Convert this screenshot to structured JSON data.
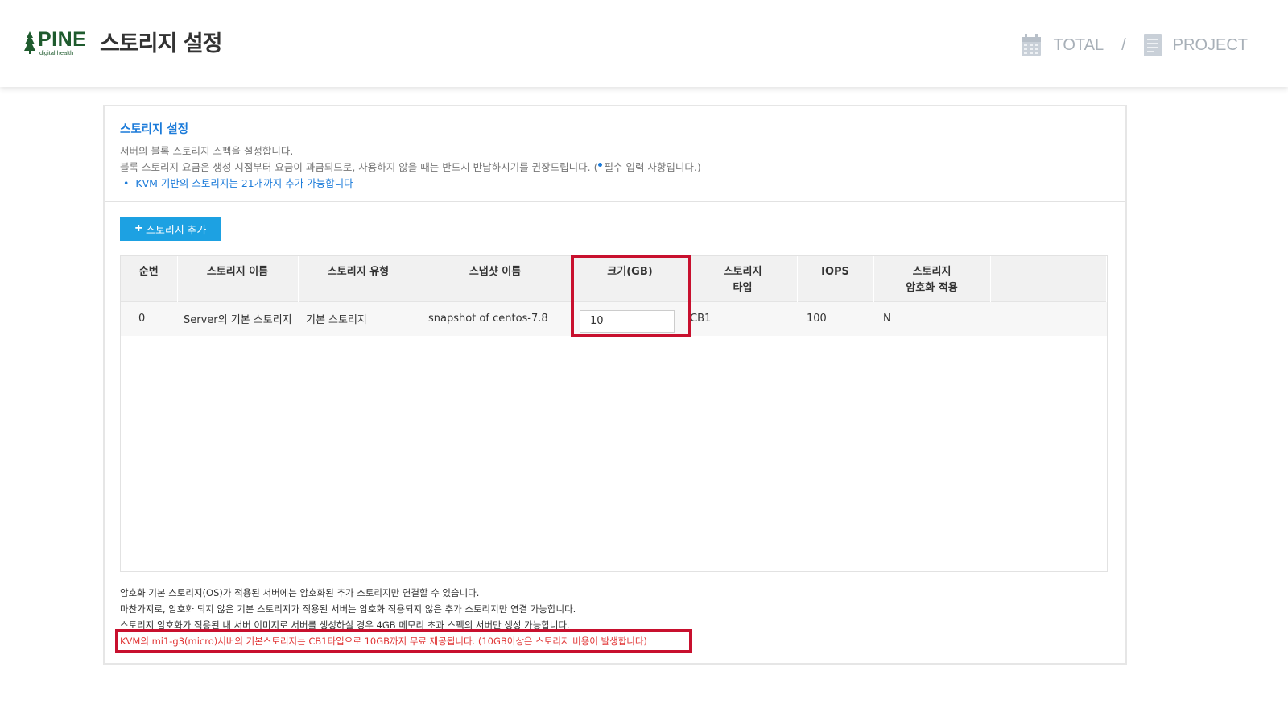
{
  "header": {
    "logo": {
      "brand": "PINE",
      "sub": "digital health"
    },
    "title": "스토리지 설정",
    "nav": [
      {
        "label": "TOTAL",
        "icon": "calendar-icon"
      },
      {
        "label": "PROJECT",
        "icon": "document-icon"
      }
    ],
    "separator": "/"
  },
  "section": {
    "title": "스토리지 설정",
    "desc1": "서버의 블록 스토리지 스펙을 설정합니다.",
    "desc2_prefix": "블록 스토리지 요금은 생성 시점부터 요금이 과금되므로, 사용하지 않을 때는 반드시 반납하시기를 권장드립니다. (",
    "desc2_suffix": "필수 입력 사항입니다.)",
    "bullet": "KVM 기반의 스토리지는 21개까지 추가 가능합니다"
  },
  "toolbar": {
    "add_label": "스토리지 추가"
  },
  "table": {
    "headers": [
      "순번",
      "스토리지 이름",
      "스토리지 유형",
      "스냅샷 이름",
      "크기(GB)",
      "스토리지\n타입",
      "IOPS",
      "스토리지\n암호화 적용"
    ],
    "rows": [
      {
        "no": "0",
        "name": "Server의 기본 스토리지",
        "type": "기본 스토리지",
        "snapshot": "snapshot of centos-7.8",
        "size": "10",
        "storage_type": "CB1",
        "iops": "100",
        "encrypt": "N"
      }
    ]
  },
  "notes": [
    "암호화 기본 스토리지(OS)가 적용된 서버에는 암호화된 추가 스토리지만 연결할 수 있습니다.",
    "마찬가지로, 암호화 되지 않은 기본 스토리지가 적용된 서버는 암호화 적용되지 않은 추가 스토리지만 연결 가능합니다.",
    "스토리지 암호화가 적용된 내 서버 이미지로 서버를 생성하실 경우 4GB 메모리 초과 스펙의 서버만 생성 가능합니다."
  ],
  "warning": "KVM의 mi1-g3(micro)서버의 기본스토리지는 CB1타입으로 10GB까지 무료 제공됩니다. (10GB이상은 스토리지 비용이 발생합니다)",
  "colors": {
    "accent": "#1a7ad9",
    "button": "#1da1e2",
    "highlight": "#c8102e",
    "warning": "#e03535",
    "logo": "#1f5b2e"
  }
}
